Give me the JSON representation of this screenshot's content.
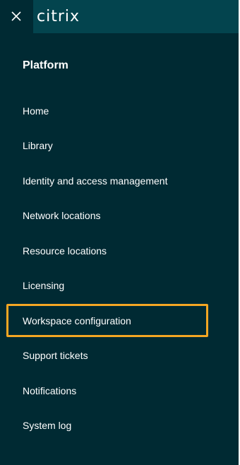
{
  "header": {
    "close_icon": "close-icon",
    "logo_text": "citrix"
  },
  "sidebar": {
    "section_title": "Platform",
    "items": [
      {
        "label": "Home"
      },
      {
        "label": "Library"
      },
      {
        "label": "Identity and access management"
      },
      {
        "label": "Network locations"
      },
      {
        "label": "Resource locations"
      },
      {
        "label": "Licensing"
      },
      {
        "label": "Workspace configuration",
        "highlighted": true
      },
      {
        "label": "Support tickets"
      },
      {
        "label": "Notifications"
      },
      {
        "label": "System log"
      }
    ]
  },
  "colors": {
    "panel_background": "#002a33",
    "topbar_background": "#03444e",
    "text": "#ffffff",
    "highlight_border": "#f5a623"
  }
}
